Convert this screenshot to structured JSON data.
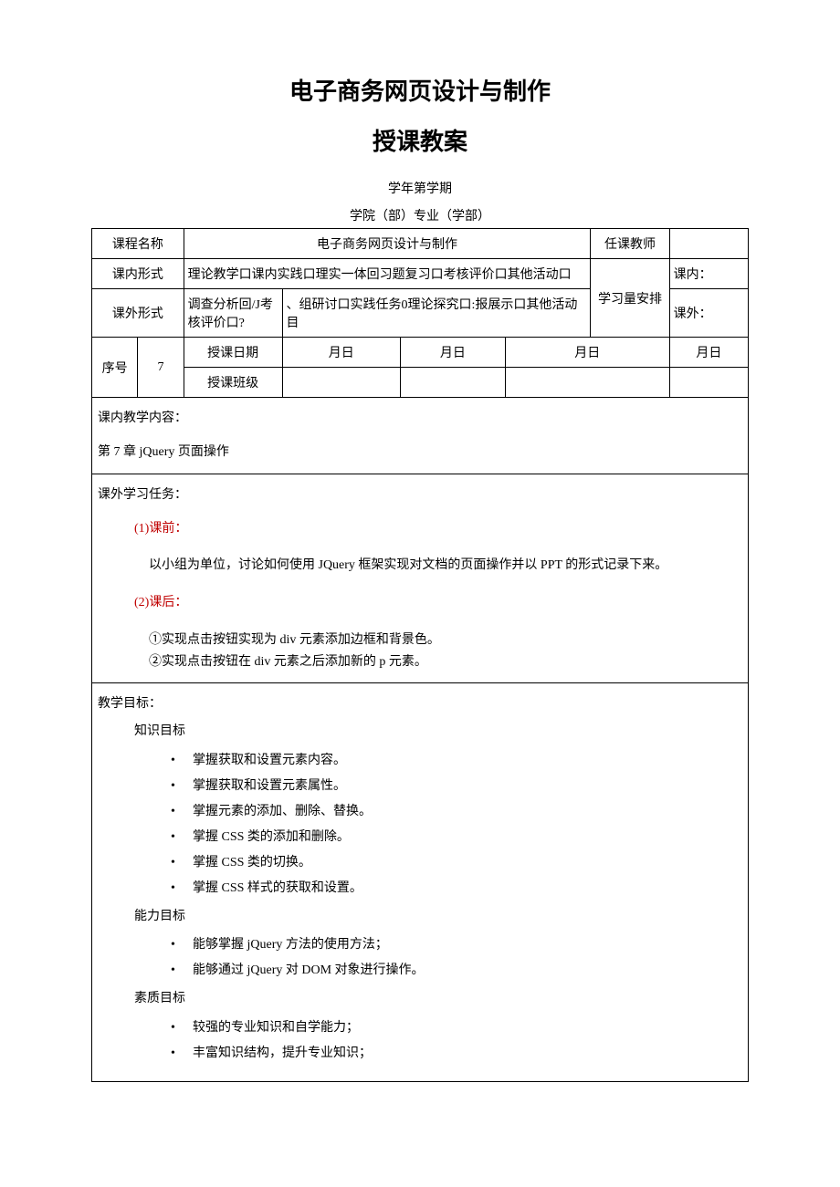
{
  "title_main": "电子商务网页设计与制作",
  "title_sub": "授课教案",
  "semester": "学年第学期",
  "college": "学院（部）专业（学部）",
  "header_table": {
    "course_name_label": "课程名称",
    "course_name_value": "电子商务网页设计与制作",
    "teacher_label": "任课教师",
    "inclass_form_label": "课内形式",
    "inclass_form_value": "理论教学口课内实践口理实一体回习题复习口考核评价口其他活动口",
    "outclass_form_label": "课外形式",
    "outclass_form_value_a": "调查分析回/J考核评价口?",
    "outclass_form_value_b": "、组研讨口实践任务0理论探究口:报展示口其他活动目",
    "workload_label": "学习量安排",
    "inclass_label": "课内：",
    "outclass_label": "课外：",
    "seq_label": "序号",
    "seq_value": "7",
    "date_label": "授课日期",
    "class_label": "授课班级",
    "md1": "月日",
    "md2": "月日",
    "md3": "月日",
    "md4": "月日"
  },
  "content_inclass": {
    "label": "课内教学内容：",
    "text": "第 7 章 jQuery 页面操作"
  },
  "content_outclass": {
    "label": "课外学习任务：",
    "pre_label": "(1)课前：",
    "pre_text": "以小组为单位，讨论如何使用 JQuery 框架实现对文档的页面操作并以 PPT 的形式记录下来。",
    "post_label": "(2)课后：",
    "post_item1": "①实现点击按钮实现为 div 元素添加边框和背景色。",
    "post_item2": "②实现点击按钮在 div 元素之后添加新的 p 元素。"
  },
  "goals": {
    "label": "教学目标：",
    "knowledge_label": "知识目标",
    "knowledge": [
      "掌握获取和设置元素内容。",
      "掌握获取和设置元素属性。",
      "掌握元素的添加、删除、替换。",
      "掌握 CSS 类的添加和删除。",
      "掌握 CSS 类的切换。",
      "掌握 CSS 样式的获取和设置。"
    ],
    "ability_label": "能力目标",
    "ability": [
      "能够掌握 jQuery 方法的使用方法；",
      "能够通过 jQuery 对 DOM 对象进行操作。"
    ],
    "quality_label": "素质目标",
    "quality": [
      "较强的专业知识和自学能力；",
      "丰富知识结构，提升专业知识；"
    ]
  }
}
